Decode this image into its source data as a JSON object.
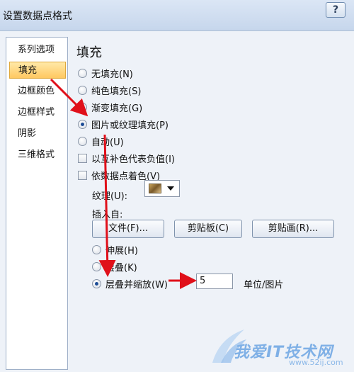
{
  "window": {
    "title": "设置数据点格式",
    "help_label": "?"
  },
  "sidebar": {
    "items": [
      {
        "label": "系列选项",
        "selected": false
      },
      {
        "label": "填充",
        "selected": true
      },
      {
        "label": "边框颜色",
        "selected": false
      },
      {
        "label": "边框样式",
        "selected": false
      },
      {
        "label": "阴影",
        "selected": false
      },
      {
        "label": "三维格式",
        "selected": false
      }
    ]
  },
  "fill": {
    "title": "填充",
    "options": {
      "no_fill": "无填充(N)",
      "solid_fill": "纯色填充(S)",
      "gradient_fill": "渐变填充(G)",
      "picture_texture_fill": "图片或纹理填充(P)",
      "automatic": "自动(U)"
    },
    "selected_option": "picture_texture_fill",
    "checkboxes": {
      "invert_if_negative": "以互补色代表负值(I)",
      "vary_colors": "依数据点着色(V)"
    },
    "texture_label": "纹理(U):",
    "texture_name": "texture-swatch",
    "insert_from_label": "插入自:",
    "buttons": {
      "file": "文件(F)...",
      "clipboard": "剪贴板(C)",
      "clip_art": "剪贴画(R)..."
    },
    "stack_options": {
      "stretch": "伸展(H)",
      "stack": "层叠(K)",
      "stack_and_scale": "层叠并缩放(W)"
    },
    "stack_selected": "stack_and_scale",
    "units_value": "5",
    "units_label": "单位/图片"
  },
  "watermark": {
    "text": "我爱IT技术网",
    "url": "www.52ij.com"
  },
  "colors": {
    "arrow": "#e0101a",
    "selection": "#ffc861",
    "accent": "#1c4c96"
  }
}
